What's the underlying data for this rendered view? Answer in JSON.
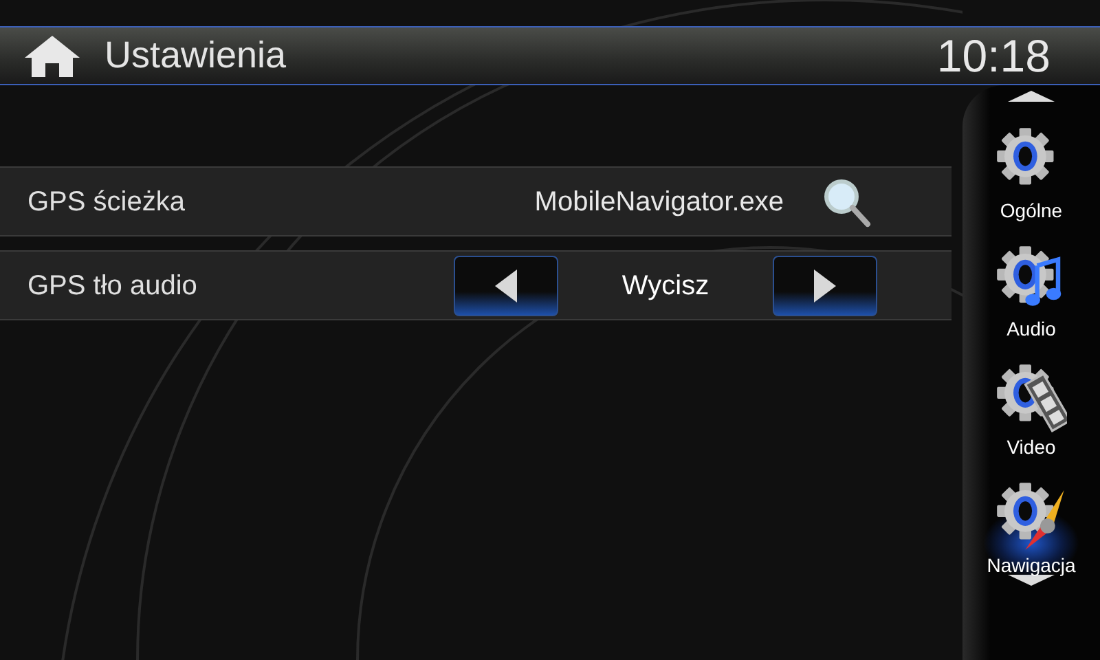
{
  "header": {
    "title": "Ustawienia",
    "time": "10:18"
  },
  "rows": [
    {
      "kind": "file",
      "label": "GPS ścieżka",
      "value": "MobileNavigator.exe"
    },
    {
      "kind": "selector",
      "label": "GPS tło audio",
      "value": "Wycisz"
    }
  ],
  "sidebar": {
    "items": [
      {
        "kind": "general",
        "label": "Ogólne",
        "selected": false
      },
      {
        "kind": "audio",
        "label": "Audio",
        "selected": false
      },
      {
        "kind": "video",
        "label": "Video",
        "selected": false
      },
      {
        "kind": "navigation",
        "label": "Nawigacja",
        "selected": true
      }
    ]
  }
}
